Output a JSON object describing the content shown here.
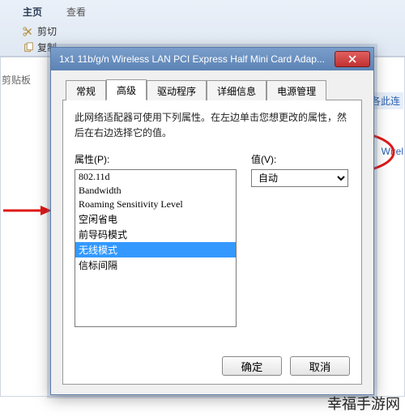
{
  "colors": {
    "accent": "#3399ff",
    "titlebar": "#5b83b5",
    "close": "#c13030",
    "annot": "#e01818"
  },
  "background": {
    "tab_main": "主页",
    "tab_view": "查看",
    "cut": "剪切",
    "copy": "复制",
    "clipboard_group": "剪贴板",
    "link_right": "各此连",
    "text_wirel": "Wirel"
  },
  "dialog": {
    "title": "1x1 11b/g/n Wireless LAN PCI Express Half Mini Card Adap...",
    "tabs": [
      "常规",
      "高级",
      "驱动程序",
      "详细信息",
      "电源管理"
    ],
    "active_tab": 1,
    "description": "此网络适配器可使用下列属性。在左边单击您想更改的属性，然后在右边选择它的值。",
    "property_label": "属性(P):",
    "value_label": "值(V):",
    "properties": [
      "802.11d",
      "Bandwidth",
      "Roaming Sensitivity Level",
      "空闲省电",
      "前导码模式",
      "无线模式",
      "信标间隔"
    ],
    "selected_index": 5,
    "value_selected": "自动",
    "btn_ok": "确定",
    "btn_cancel": "取消"
  },
  "watermark": "幸福手游网"
}
